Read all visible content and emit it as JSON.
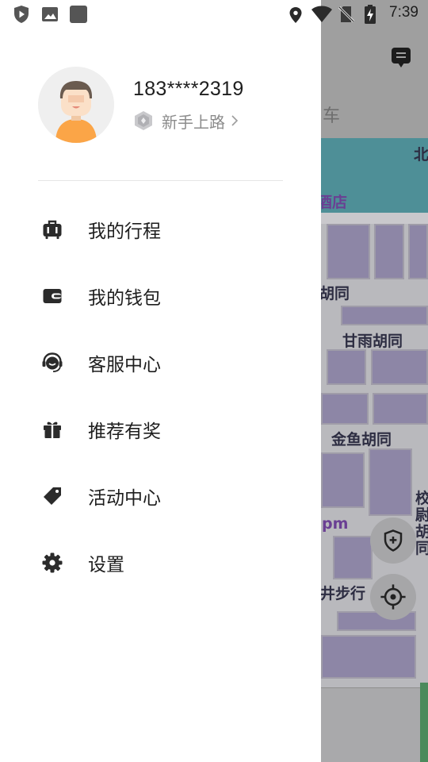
{
  "status_bar": {
    "time": "7:39",
    "left_icons": [
      "shield-play-icon",
      "image-icon",
      "app-square-icon"
    ],
    "right_icons": [
      "location-pin-icon",
      "wifi-icon",
      "no-sim-icon",
      "battery-charging-icon"
    ]
  },
  "profile": {
    "phone": "183****2319",
    "level": "新手上路"
  },
  "menu": {
    "items": [
      {
        "label": "我的行程",
        "icon": "suitcase-icon"
      },
      {
        "label": "我的钱包",
        "icon": "wallet-icon"
      },
      {
        "label": "客服中心",
        "icon": "headset-icon"
      },
      {
        "label": "推荐有奖",
        "icon": "gift-icon"
      },
      {
        "label": "活动中心",
        "icon": "tag-icon"
      },
      {
        "label": "设置",
        "icon": "gear-icon"
      }
    ]
  },
  "background": {
    "tab_fragment": "车",
    "map_labels": [
      "北",
      "酒店",
      "胡同",
      "甘雨胡同",
      "金鱼胡同",
      "pm",
      "井步行",
      "校尉胡同"
    ]
  },
  "colors": {
    "drawer_bg": "#ffffff",
    "scrim": "#9f9f9f",
    "text_primary": "#1e1e1e",
    "text_secondary": "#8c8c8c"
  }
}
